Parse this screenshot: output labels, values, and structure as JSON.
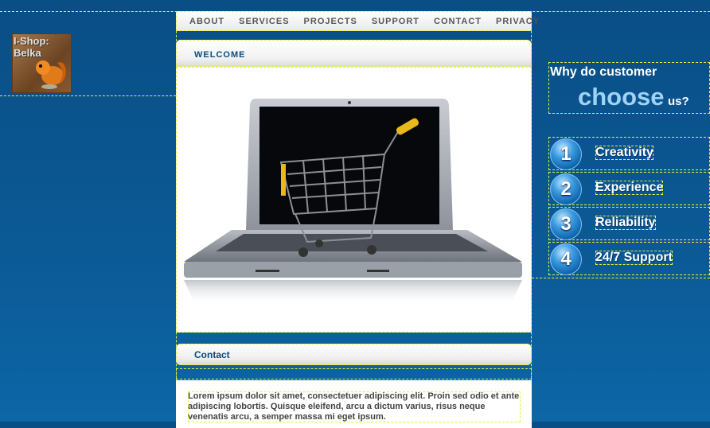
{
  "logo": {
    "text_line1": "I-Shop:",
    "text_line2": "Belka"
  },
  "nav": {
    "items": [
      "ABOUT",
      "SERVICES",
      "PROJECTS",
      "SUPPORT",
      "CONTACT",
      "PRIVACY"
    ]
  },
  "welcome": {
    "title": "WELCOME"
  },
  "contact": {
    "title": "Contact",
    "body": "Lorem ipsum dolor sit amet, consectetuer adipiscing elit. Proin sed odio et ante adipiscing lobortis. Quisque eleifend, arcu a dictum varius, risus neque venenatis arcu, a semper massa mi eget ipsum."
  },
  "why": {
    "line1": "Why do customer",
    "line2": "choose",
    "line3": "us?"
  },
  "reasons": [
    {
      "number": "1",
      "label": "Creativity"
    },
    {
      "number": "2",
      "label": "Experience"
    },
    {
      "number": "3",
      "label": "Reliability"
    },
    {
      "number": "4",
      "label": "24/7 Support"
    }
  ]
}
